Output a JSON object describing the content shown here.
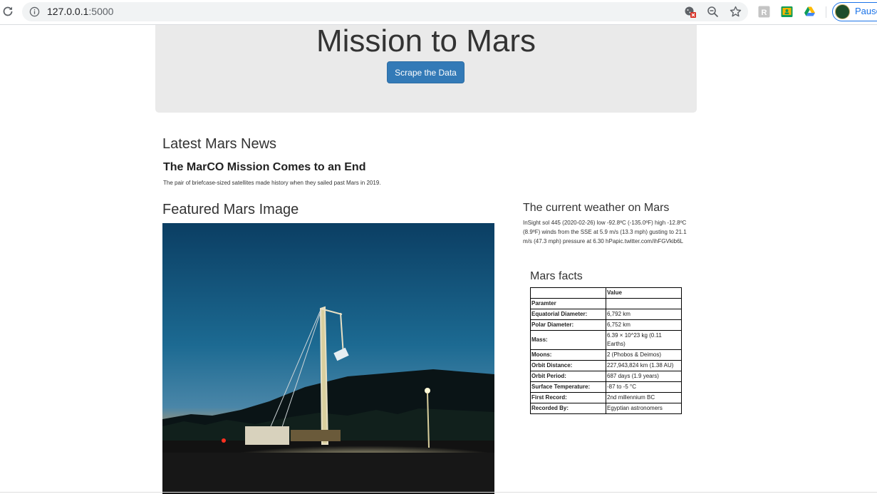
{
  "browser": {
    "url_host": "127.0.0.1",
    "url_port": ":5000",
    "profile_label": "Pause"
  },
  "jumbotron": {
    "title": "Mission to Mars",
    "button_label": "Scrape the Data"
  },
  "news": {
    "heading": "Latest Mars News",
    "title": "The MarCO Mission Comes to an End",
    "paragraph": "The pair of briefcase-sized satellites made history when they sailed past Mars in 2019."
  },
  "featured": {
    "heading": "Featured Mars Image"
  },
  "weather": {
    "heading": "The current weather on Mars",
    "text": "InSight sol 445 (2020-02-26) low -92.8ºC (-135.0ºF) high -12.8ºC (8.9ºF) winds from the SSE at 5.9 m/s (13.3 mph) gusting to 21.1 m/s (47.3 mph) pressure at 6.30 hPapic.twitter.com/ihFGVkib6L"
  },
  "facts": {
    "heading": "Mars facts",
    "header_col1": "",
    "header_col2": "Value",
    "index_label": "Paramter",
    "rows": [
      {
        "param": "Equatorial Diameter:",
        "value": "6,792 km"
      },
      {
        "param": "Polar Diameter:",
        "value": "6,752 km"
      },
      {
        "param": "Mass:",
        "value": "6.39 × 10^23 kg (0.11 Earths)"
      },
      {
        "param": "Moons:",
        "value": "2 (Phobos & Deimos)"
      },
      {
        "param": "Orbit Distance:",
        "value": "227,943,824 km (1.38 AU)"
      },
      {
        "param": "Orbit Period:",
        "value": "687 days (1.9 years)"
      },
      {
        "param": "Surface Temperature:",
        "value": "-87 to -5 °C"
      },
      {
        "param": "First Record:",
        "value": "2nd millennium BC"
      },
      {
        "param": "Recorded By:",
        "value": "Egyptian astronomers"
      }
    ]
  },
  "colors": {
    "button": "#337ab7",
    "jumbotron_bg": "#eaeaea",
    "profile_accent": "#1a73e8"
  }
}
